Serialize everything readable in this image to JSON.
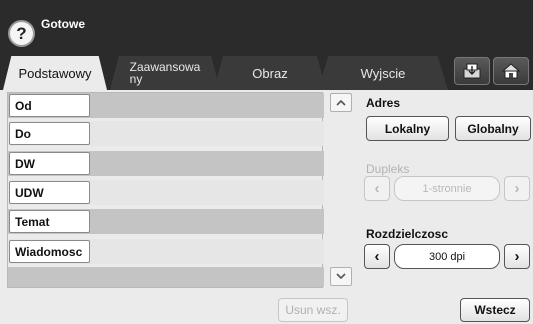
{
  "header": {
    "status": "Gotowe",
    "help_symbol": "?"
  },
  "tabs": [
    {
      "label": "Podstawowy",
      "active": true
    },
    {
      "label_line1": "Zaawansowa",
      "label_line2": "ny",
      "active": false
    },
    {
      "label": "Obraz",
      "active": false
    },
    {
      "label": "Wyjscie",
      "active": false
    }
  ],
  "toolbar_icons": [
    "job-status-icon",
    "home-icon"
  ],
  "recipients": [
    {
      "label": "Od"
    },
    {
      "label": "Do"
    },
    {
      "label": "DW"
    },
    {
      "label": "UDW"
    },
    {
      "label": "Temat"
    },
    {
      "label": "Wiadomosc"
    }
  ],
  "clear_all": "Usun wsz.",
  "address": {
    "title": "Adres",
    "local": "Lokalny",
    "global": "Globalny"
  },
  "duplex": {
    "title": "Dupleks",
    "value": "1-stronnie",
    "enabled": false
  },
  "resolution": {
    "title": "Rozdzielczosc",
    "value": "300 dpi",
    "enabled": true
  },
  "back_button": "Wstecz"
}
